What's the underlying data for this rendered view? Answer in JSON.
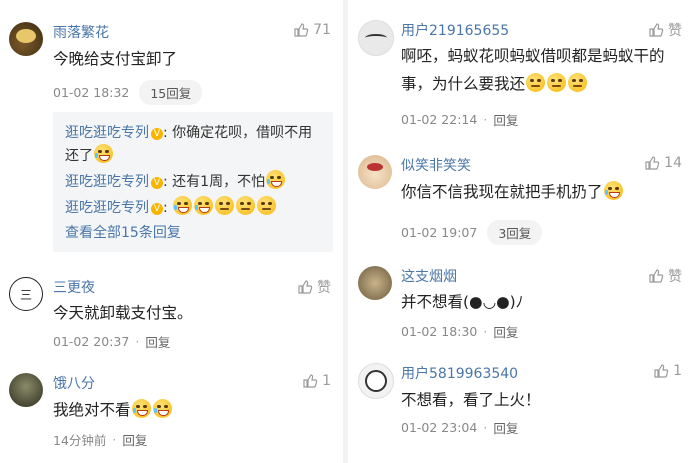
{
  "left": [
    {
      "username": "雨落繁花",
      "likes": "71",
      "text": "今晚给支付宝卸了",
      "time": "01-02 18:32",
      "replies": "15回复",
      "sub_replies": [
        {
          "user": "逛吃逛吃专列",
          "text": ": 你确定花呗，借呗不用还了",
          "emoji": [
            "laugh-cry"
          ]
        },
        {
          "user": "逛吃逛吃专列",
          "text": ": 还有1周，不怕",
          "emoji": [
            "laugh-cry"
          ]
        },
        {
          "user": "逛吃逛吃专列",
          "text": ":",
          "emoji": [
            "laugh-cry",
            "laugh-cry",
            "smirk",
            "smirk",
            "smirk"
          ]
        }
      ],
      "view_all": "查看全部15条回复"
    },
    {
      "username": "三更夜",
      "likes": "赞",
      "text": "今天就卸载支付宝。",
      "time": "01-02 20:37",
      "reply": "回复"
    },
    {
      "username": "饿八分",
      "likes": "1",
      "text": "我绝对不看",
      "text_emoji": [
        "laugh-cry",
        "laugh-cry"
      ],
      "time": "14分钟前",
      "reply": "回复"
    }
  ],
  "right": [
    {
      "username": "用户219165655",
      "likes": "赞",
      "text_line1": "啊呸，蚂蚁花呗蚂蚁借呗都是蚂蚁干的",
      "text_line2": "事，为什么要我还",
      "text_emoji": [
        "sad",
        "sad",
        "sad"
      ],
      "time": "01-02 22:14",
      "reply": "回复"
    },
    {
      "username": "似笑非笑笑",
      "likes": "14",
      "text": "你信不信我现在就把手机扔了",
      "text_emoji": [
        "cry"
      ],
      "time": "01-02 19:07",
      "replies": "3回复"
    },
    {
      "username": "这支烟烟",
      "likes": "赞",
      "text": "并不想看(●◡●)ﾉ",
      "time": "01-02 18:30",
      "reply": "回复"
    },
    {
      "username": "用户5819963540",
      "likes": "1",
      "text": "不想看，看了上火！",
      "time": "01-02 23:04",
      "reply": "回复"
    }
  ],
  "colors": {
    "username": "#4a76a8",
    "meta": "#888888",
    "subbox": "#f4f5f7"
  },
  "icons": {
    "like": "thumbs-up-icon",
    "verified": "verified-badge-icon"
  }
}
